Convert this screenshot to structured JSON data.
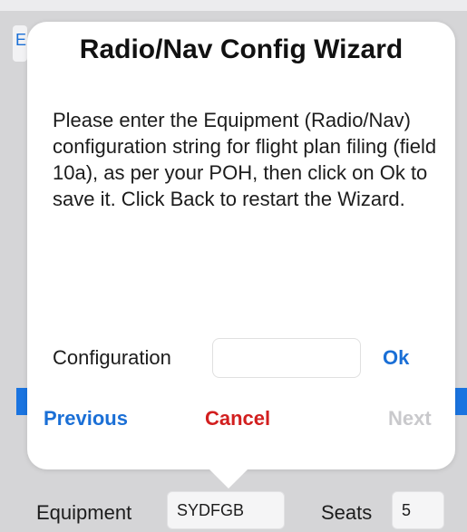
{
  "background": {
    "edge_letter": "E"
  },
  "dialog": {
    "title": "Radio/Nav Config Wizard",
    "message": "Please enter the Equipment (Radio/Nav) configuration string for flight plan filing (field 10a), as per your POH, then click on Ok to save it. Click Back to restart the Wizard.",
    "config_label": "Configuration",
    "config_value": "",
    "config_placeholder": "",
    "ok_label": "Ok",
    "previous_label": "Previous",
    "cancel_label": "Cancel",
    "next_label": "Next"
  },
  "form": {
    "equipment_label": "Equipment",
    "equipment_value": "SYDFGB",
    "seats_label": "Seats",
    "seats_value": "5"
  },
  "colors": {
    "accent": "#1a6fd6",
    "destructive": "#d21f1f",
    "disabled": "#c9c9cc"
  }
}
